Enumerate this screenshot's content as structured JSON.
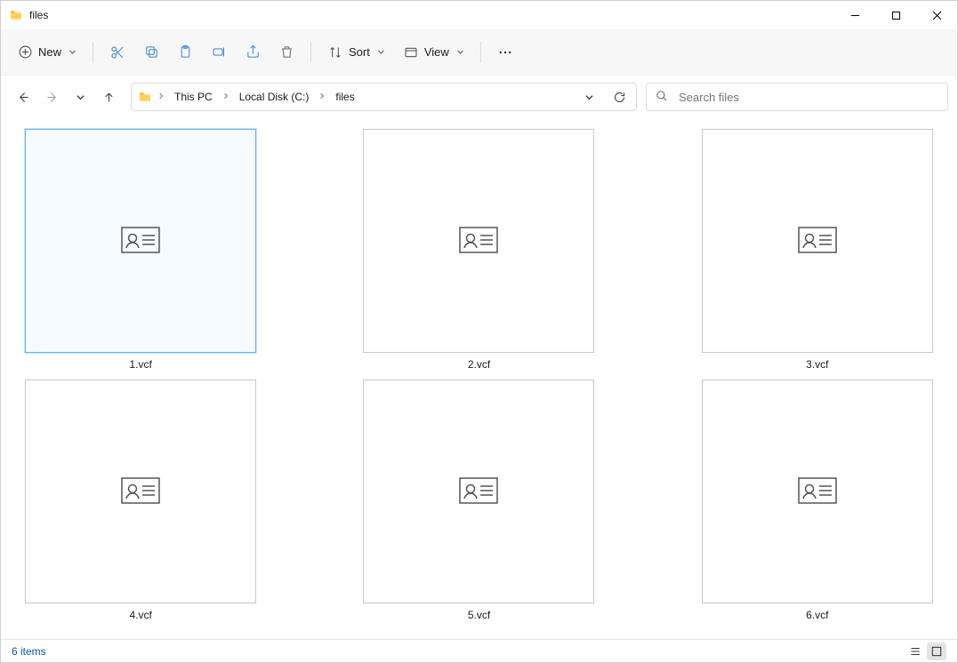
{
  "window": {
    "title": "files"
  },
  "toolbar": {
    "new_label": "New",
    "sort_label": "Sort",
    "view_label": "View"
  },
  "breadcrumb": {
    "item0": "This PC",
    "item1": "Local Disk (C:)",
    "item2": "files"
  },
  "search": {
    "placeholder": "Search files"
  },
  "files": [
    {
      "name": "1.vcf",
      "selected": true
    },
    {
      "name": "2.vcf",
      "selected": false
    },
    {
      "name": "3.vcf",
      "selected": false
    },
    {
      "name": "4.vcf",
      "selected": false
    },
    {
      "name": "5.vcf",
      "selected": false
    },
    {
      "name": "6.vcf",
      "selected": false
    }
  ],
  "status": {
    "text": "6 items"
  }
}
